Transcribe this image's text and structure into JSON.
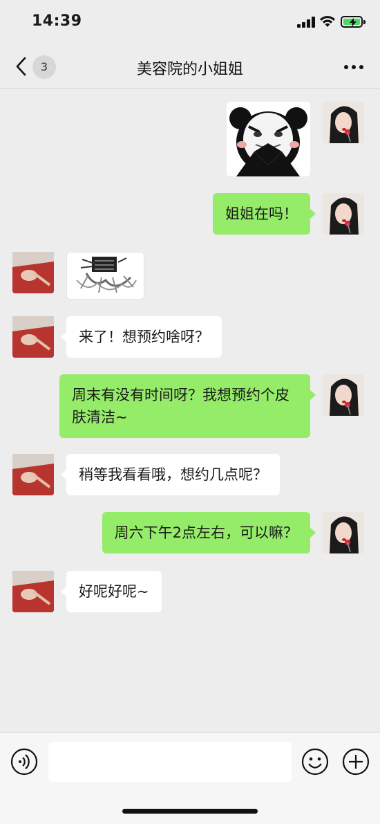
{
  "status_bar": {
    "time": "14:39",
    "battery_color": "#4cd964"
  },
  "nav": {
    "title": "美容院的小姐姐",
    "unread_count": "3"
  },
  "messages": [
    {
      "from": "self",
      "type": "sticker",
      "description_icon": "panda-meme-sticker"
    },
    {
      "from": "self",
      "type": "text",
      "text": "姐姐在吗！"
    },
    {
      "from": "other",
      "type": "sticker",
      "description_icon": "wobbling-cartoon-sticker"
    },
    {
      "from": "other",
      "type": "text",
      "text": "来了！想预约啥呀？"
    },
    {
      "from": "self",
      "type": "text",
      "text": "周末有没有时间呀？我想预约个皮肤清洁~"
    },
    {
      "from": "other",
      "type": "text",
      "text": "稍等我看看哦，想约几点呢？"
    },
    {
      "from": "self",
      "type": "text",
      "text": "周六下午2点左右，可以嘛？"
    },
    {
      "from": "other",
      "type": "text",
      "text": "好呢好呢~"
    }
  ],
  "input": {
    "value": ""
  },
  "colors": {
    "bubble_self": "#95ec69",
    "bubble_other": "#ffffff",
    "background": "#ededed"
  }
}
